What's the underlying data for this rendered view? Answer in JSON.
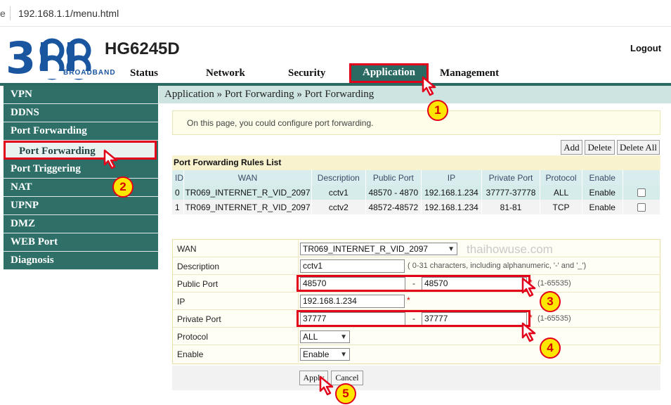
{
  "browser": {
    "prefix": "e",
    "url": "192.168.1.1/menu.html"
  },
  "header": {
    "logo_text": "3BB",
    "logo_sub": "BROADBAND",
    "model": "HG6245D",
    "logout": "Logout",
    "nav": [
      "Status",
      "Network",
      "Security",
      "Application",
      "Management"
    ],
    "active_nav": "Application"
  },
  "sidebar": {
    "items": [
      "VPN",
      "DDNS",
      "Port Forwarding",
      "Port Triggering",
      "NAT",
      "UPNP",
      "DMZ",
      "WEB Port",
      "Diagnosis"
    ],
    "subitem": "Port Forwarding"
  },
  "breadcrumb": "Application » Port Forwarding » Port Forwarding",
  "info": "On this page, you could configure port forwarding.",
  "toolbar": {
    "add": "Add",
    "delete": "Delete",
    "delete_all": "Delete All"
  },
  "rules": {
    "title": "Port Forwarding Rules List",
    "columns": [
      "ID",
      "WAN",
      "Description",
      "Public Port",
      "IP",
      "Private Port",
      "Protocol",
      "Enable"
    ],
    "rows": [
      {
        "id": "0",
        "wan": "TR069_INTERNET_R_VID_2097",
        "desc": "cctv1",
        "public": "48570 - 4870",
        "ip": "192.168.1.234",
        "private": "37777-37778",
        "protocol": "ALL",
        "enable": "Enable"
      },
      {
        "id": "1",
        "wan": "TR069_INTERNET_R_VID_2097",
        "desc": "cctv2",
        "public": "48572-48572",
        "ip": "192.168.1.234",
        "private": "81-81",
        "protocol": "TCP",
        "enable": "Enable"
      }
    ]
  },
  "form": {
    "labels": {
      "wan": "WAN",
      "description": "Description",
      "public_port": "Public Port",
      "ip": "IP",
      "private_port": "Private Port",
      "protocol": "Protocol",
      "enable": "Enable"
    },
    "wan_value": "TR069_INTERNET_R_VID_2097",
    "description_value": "cctv1",
    "description_hint": "( 0-31 characters, including alphanumeric, '-' and '_')",
    "public_start": "48570",
    "public_end": "48570",
    "ip_value": "192.168.1.234",
    "private_start": "37777",
    "private_end": "37777",
    "port_hint": "(1-65535)",
    "protocol_value": "ALL",
    "enable_value": "Enable",
    "dash": "-",
    "req": "*"
  },
  "actions": {
    "apply": "Apply",
    "cancel": "Cancel"
  },
  "watermark": "thaihowuse.com",
  "callouts": [
    "1",
    "2",
    "3",
    "4",
    "5"
  ],
  "colors": {
    "theme": "#2e7068",
    "highlight": "#e3001b",
    "callout": "#fde600"
  }
}
